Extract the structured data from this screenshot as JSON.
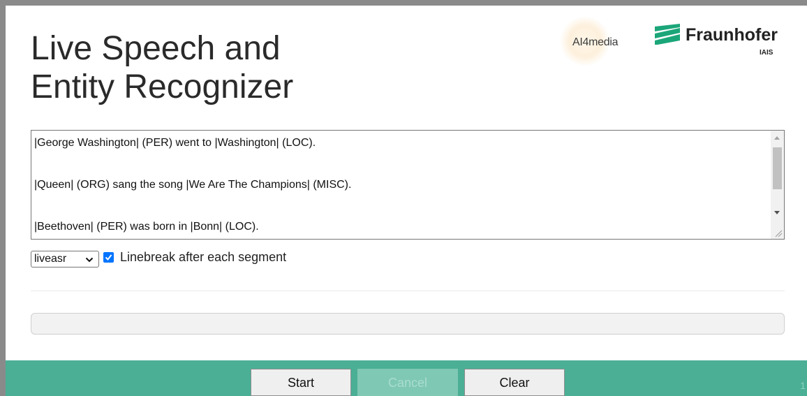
{
  "header": {
    "title_line1": "Live Speech and",
    "title_line2": "Entity Recognizer",
    "logo_ai4media": "AI4media",
    "logo_fraunhofer": "Fraunhofer",
    "logo_fraunhofer_sub": "IAIS"
  },
  "transcript": {
    "lines": [
      "|George Washington| (PER) went to |Washington| (LOC).",
      "|Queen| (ORG) sang the song |We Are The Champions| (MISC).",
      "|Beethoven| (PER) was born in |Bonn| (LOC)."
    ]
  },
  "controls": {
    "model_select_value": "liveasr",
    "linebreak_checked": true,
    "linebreak_label": "Linebreak after each segment"
  },
  "footer": {
    "start_label": "Start",
    "cancel_label": "Cancel",
    "clear_label": "Clear",
    "page_number": "1"
  },
  "colors": {
    "footer_bg": "#4aaf95",
    "checkbox": "#0075ff",
    "fraunhofer_green": "#1ba679"
  }
}
